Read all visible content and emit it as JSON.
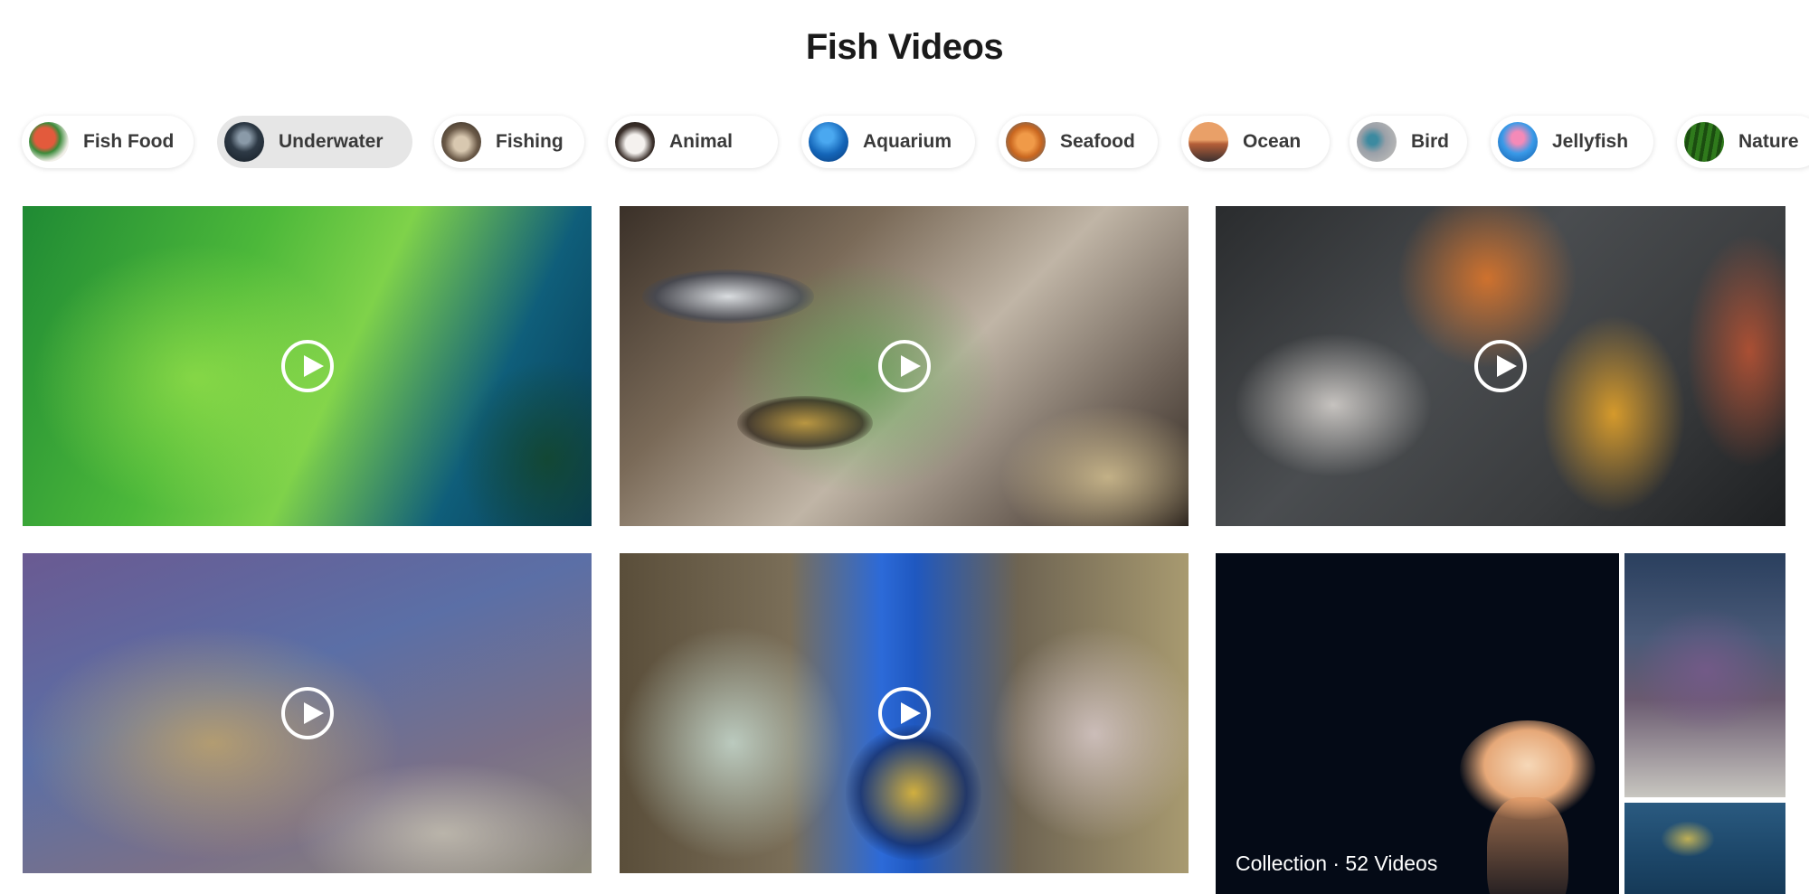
{
  "page": {
    "title": "Fish Videos"
  },
  "chips": [
    {
      "label": "Fish Food",
      "active": false
    },
    {
      "label": "Underwater",
      "active": true
    },
    {
      "label": "Fishing",
      "active": false
    },
    {
      "label": "Animal",
      "active": false
    },
    {
      "label": "Aquarium",
      "active": false
    },
    {
      "label": "Seafood",
      "active": false
    },
    {
      "label": "Ocean",
      "active": false
    },
    {
      "label": "Bird",
      "active": false
    },
    {
      "label": "Jellyfish",
      "active": false
    },
    {
      "label": "Nature",
      "active": false
    }
  ],
  "collection": {
    "label": "Collection · 52 Videos"
  },
  "icons": {
    "play": "play-icon"
  },
  "colors": {
    "play_icon": "#ffffff",
    "active_chip_bg": "#e6e6e6"
  }
}
